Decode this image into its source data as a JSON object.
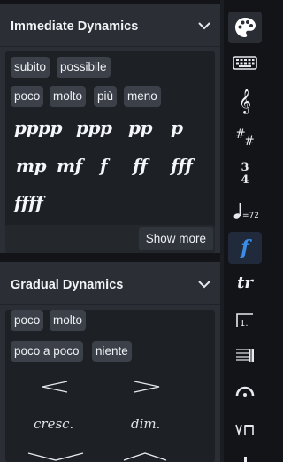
{
  "immediate": {
    "title": "Immediate Dynamics",
    "chips_row1": [
      "subito",
      "possibile"
    ],
    "chips_row2": [
      "poco",
      "molto",
      "più",
      "meno"
    ],
    "marks_row1": [
      "pppp",
      "ppp",
      "pp",
      "p"
    ],
    "marks_row2": [
      "mp",
      "mf",
      "f",
      "ff",
      "fff"
    ],
    "marks_row3": [
      "ffff"
    ],
    "show_more": "Show more"
  },
  "gradual": {
    "title": "Gradual Dynamics",
    "chips_row1": [
      "poco",
      "molto"
    ],
    "chips_row2": [
      "poco a poco",
      "niente"
    ],
    "cresc": "cresc.",
    "dim": "dim."
  },
  "sidebar": {
    "items": [
      {
        "icon": "palette-icon"
      },
      {
        "icon": "keyboard-icon"
      },
      {
        "icon": "treble-clef-icon"
      },
      {
        "icon": "key-signature-icon"
      },
      {
        "icon": "time-signature-icon",
        "top": "3",
        "bottom": "4"
      },
      {
        "icon": "tempo-icon",
        "text": "=72"
      },
      {
        "icon": "dynamics-icon",
        "text": "f"
      },
      {
        "icon": "trill-icon",
        "text": "tr"
      },
      {
        "icon": "volta-icon",
        "text": "1."
      },
      {
        "icon": "barline-icon"
      },
      {
        "icon": "fermata-icon"
      },
      {
        "icon": "bowing-icon"
      },
      {
        "icon": "more-icon"
      }
    ]
  },
  "colors": {
    "panel": "#2b2f35",
    "panel_body": "#1d2025",
    "chip": "#3b4049",
    "accent": "#3b8ee8"
  }
}
